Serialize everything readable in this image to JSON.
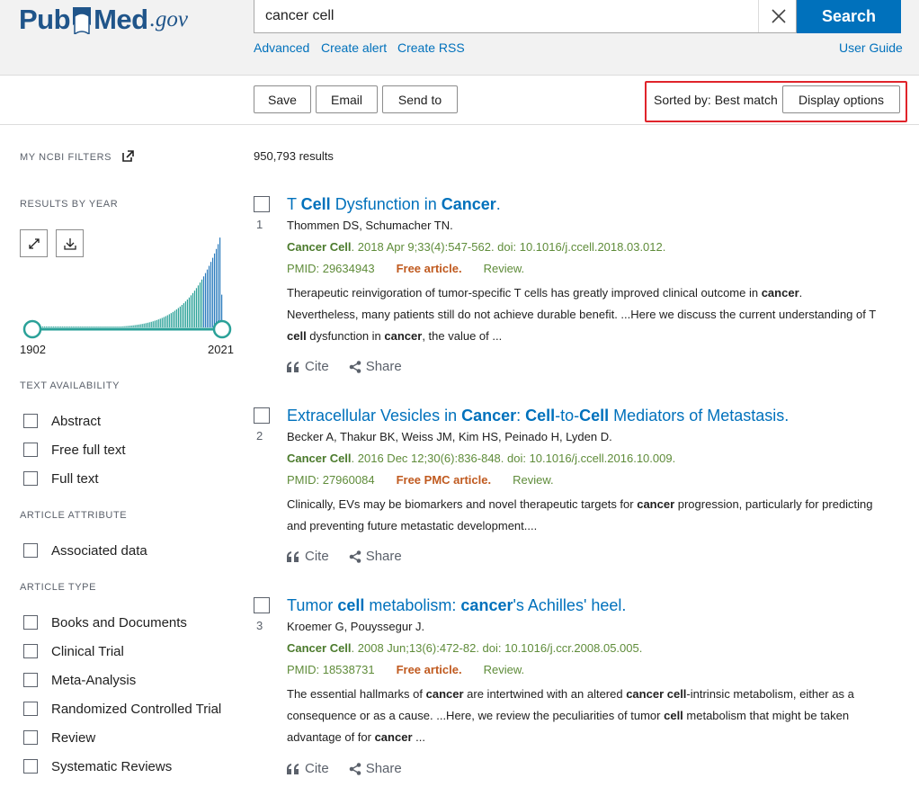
{
  "header": {
    "logo": {
      "pub": "Pub",
      "med": "Med",
      "gov": ".gov"
    },
    "search": {
      "value": "cancer cell",
      "button_label": "Search"
    },
    "links": {
      "advanced": "Advanced",
      "create_alert": "Create alert",
      "create_rss": "Create RSS",
      "user_guide": "User Guide"
    }
  },
  "toolbar": {
    "save": "Save",
    "email": "Email",
    "send_to": "Send to",
    "sorted_by": "Sorted by: Best match",
    "display_options": "Display options"
  },
  "sidebar": {
    "my_ncbi_filters": "MY NCBI FILTERS",
    "results_by_year": "RESULTS BY YEAR",
    "year_start": "1902",
    "year_end": "2021",
    "text_availability": {
      "heading": "TEXT AVAILABILITY",
      "items": [
        "Abstract",
        "Free full text",
        "Full text"
      ]
    },
    "article_attribute": {
      "heading": "ARTICLE ATTRIBUTE",
      "items": [
        "Associated data"
      ]
    },
    "article_type": {
      "heading": "ARTICLE TYPE",
      "items": [
        "Books and Documents",
        "Clinical Trial",
        "Meta-Analysis",
        "Randomized Controlled Trial",
        "Review",
        "Systematic Reviews"
      ]
    }
  },
  "results": {
    "count": "950,793 results",
    "cite_label": "Cite",
    "share_label": "Share",
    "items": [
      {
        "num": "1",
        "title": [
          {
            "t": "T "
          },
          {
            "b": "Cell"
          },
          {
            "t": " Dysfunction in "
          },
          {
            "b": "Cancer"
          },
          {
            "t": "."
          }
        ],
        "authors": "Thommen DS, Schumacher TN.",
        "journal": "Cancer Cell",
        "citation": ". 2018 Apr 9;33(4):547-562. doi: 10.1016/j.ccell.2018.03.012.",
        "pmid": "PMID: 29634943",
        "free": "Free article.",
        "type": "Review.",
        "snippet": [
          {
            "t": "Therapeutic reinvigoration of tumor-specific T cells has greatly improved clinical outcome in "
          },
          {
            "b": "cancer"
          },
          {
            "t": ". Nevertheless, many patients still do not achieve durable benefit. ...Here we discuss the current understanding of T "
          },
          {
            "b": "cell"
          },
          {
            "t": " dysfunction in "
          },
          {
            "b": "cancer"
          },
          {
            "t": ", the value of ..."
          }
        ]
      },
      {
        "num": "2",
        "title": [
          {
            "t": "Extracellular Vesicles in "
          },
          {
            "b": "Cancer"
          },
          {
            "t": ": "
          },
          {
            "b": "Cell"
          },
          {
            "t": "-to-"
          },
          {
            "b": "Cell"
          },
          {
            "t": " Mediators of Metastasis."
          }
        ],
        "authors": "Becker A, Thakur BK, Weiss JM, Kim HS, Peinado H, Lyden D.",
        "journal": "Cancer Cell",
        "citation": ". 2016 Dec 12;30(6):836-848. doi: 10.1016/j.ccell.2016.10.009.",
        "pmid": "PMID: 27960084",
        "free": "Free PMC article.",
        "type": "Review.",
        "snippet": [
          {
            "t": "Clinically, EVs may be biomarkers and novel therapeutic targets for "
          },
          {
            "b": "cancer"
          },
          {
            "t": " progression, particularly for predicting and preventing future metastatic development...."
          }
        ]
      },
      {
        "num": "3",
        "title": [
          {
            "t": "Tumor "
          },
          {
            "b": "cell"
          },
          {
            "t": " metabolism: "
          },
          {
            "b": "cancer"
          },
          {
            "t": "'s Achilles' heel."
          }
        ],
        "authors": "Kroemer G, Pouyssegur J.",
        "journal": "Cancer Cell",
        "citation": ". 2008 Jun;13(6):472-82. doi: 10.1016/j.ccr.2008.05.005.",
        "pmid": "PMID: 18538731",
        "free": "Free article.",
        "type": "Review.",
        "snippet": [
          {
            "t": "The essential hallmarks of "
          },
          {
            "b": "cancer"
          },
          {
            "t": " are intertwined with an altered "
          },
          {
            "b": "cancer cell"
          },
          {
            "t": "-intrinsic metabolism, either as a consequence or as a cause. ...Here, we review the peculiarities of tumor "
          },
          {
            "b": "cell"
          },
          {
            "t": " metabolism that might be taken advantage of for "
          },
          {
            "b": "cancer"
          },
          {
            "t": " ..."
          }
        ]
      }
    ]
  },
  "colors": {
    "brand": "#20558a",
    "link": "#0071bc",
    "search_button": "#0071bc",
    "citation": "#5f8c3a",
    "free": "#c05a1f",
    "highlight": "#e0242b",
    "chart": "#2aa198"
  }
}
